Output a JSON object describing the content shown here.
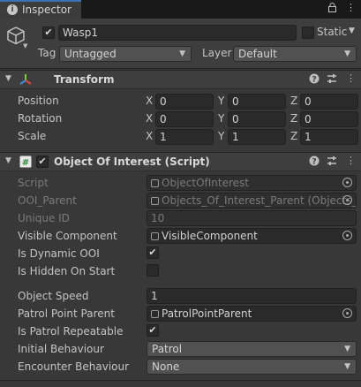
{
  "tab": {
    "label": "Inspector"
  },
  "header": {
    "name": "Wasp1",
    "static_label": "Static",
    "tag_label": "Tag",
    "tag_value": "Untagged",
    "layer_label": "Layer",
    "layer_value": "Default"
  },
  "transform": {
    "title": "Transform",
    "rows": [
      {
        "label": "Position",
        "x": "0",
        "y": "0",
        "z": "0"
      },
      {
        "label": "Rotation",
        "x": "0",
        "y": "0",
        "z": "0"
      },
      {
        "label": "Scale",
        "x": "1",
        "y": "1",
        "z": "1"
      }
    ],
    "axes": {
      "x": "X",
      "y": "Y",
      "z": "Z"
    }
  },
  "script_component": {
    "title": "Object Of Interest (Script)",
    "script_label": "Script",
    "script_value": "ObjectOfInterest",
    "ooi_parent_label": "OOI_Parent",
    "ooi_parent_value": "Objects_Of_Interest_Parent (Objects_",
    "unique_id_label": "Unique ID",
    "unique_id_value": "10",
    "visible_component_label": "Visible Component",
    "visible_component_value": "VisibleComponent",
    "is_dynamic_label": "Is Dynamic OOI",
    "is_hidden_label": "Is Hidden On Start",
    "object_speed_label": "Object Speed",
    "object_speed_value": "1",
    "patrol_parent_label": "Patrol Point Parent",
    "patrol_parent_value": "PatrolPointParent",
    "patrol_repeatable_label": "Is Patrol Repeatable",
    "initial_behaviour_label": "Initial Behaviour",
    "initial_behaviour_value": "Patrol",
    "encounter_behaviour_label": "Encounter Behaviour",
    "encounter_behaviour_value": "None"
  },
  "icons": {
    "check": "✔",
    "dropdown": "▼",
    "fold": "▼",
    "help": "?",
    "settings": "⇄",
    "more": "⋮",
    "lock": "🔒"
  }
}
